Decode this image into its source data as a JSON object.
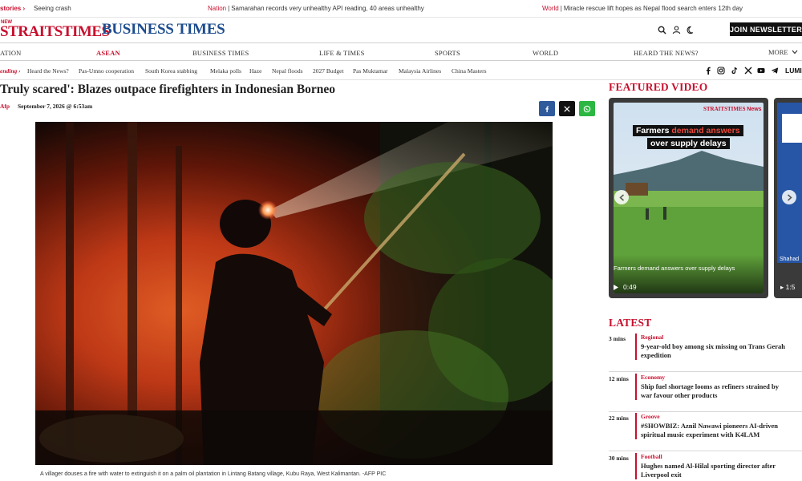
{
  "ticker": {
    "label": "stories ›",
    "items": [
      {
        "category": "",
        "text": "Seeing crash"
      },
      {
        "category": "Nation",
        "text": "Samarahan records very unhealthy API reading, 40 areas unhealthy"
      },
      {
        "category": "World",
        "text": "Miracle rescue lift hopes as Nepal flood search enters 12th day"
      }
    ]
  },
  "masthead": {
    "nst_small": "NEW",
    "nst_logo": "STRAITSTIMES",
    "bt_logo": "BUSINESS TIMES",
    "join_label": "JOIN NEWSLETTER"
  },
  "nav": {
    "items": [
      "ATION",
      "ASEAN",
      "BUSINESS TIMES",
      "LIFE & TIMES",
      "SPORTS",
      "WORLD",
      "HEARD THE NEWS?"
    ],
    "active": "ASEAN",
    "more": "MORE"
  },
  "trending": {
    "label": "ending ›",
    "items": [
      "Heard the News?",
      "Pas-Umno cooperation",
      "South Korea stabbing",
      "Melaka polls",
      "Haze",
      "Nepal floods",
      "2027 Budget",
      "Pas Muktamar",
      "Malaysia Airlines",
      "China Masters"
    ],
    "social_trailing": "LUMI"
  },
  "article": {
    "headline": "Truly scared': Blazes outpace firefighters in Indonesian Borneo",
    "author": "Afp",
    "date": "September 7, 2026 @ 6:53am",
    "caption": "A villager douses a fire with water to extinguish it on a palm oil plantation in Lintang Batang village, Kubu Raya, West Kalimantan. -AFP PIC"
  },
  "featured": {
    "title": "FEATURED VIDEO",
    "video": {
      "logo": "STRAITSTIMES",
      "logo_suffix": "News",
      "headline_white_1": "Farmers ",
      "headline_red": "demand answers",
      "headline_white_2": "over supply delays",
      "caption": "Farmers demand answers over supply delays",
      "duration": "0:49"
    },
    "video2": {
      "duration": "1:5",
      "caption": "Shahad"
    }
  },
  "latest": {
    "title": "LATEST",
    "items": [
      {
        "time": "3 mins",
        "category": "Regional",
        "title_1": "9-year-old boy among six missing on Trans Gerah",
        "title_2": "expedition"
      },
      {
        "time": "12 mins",
        "category": "Economy",
        "title_1": "Ship fuel shortage looms as refiners strained by",
        "title_2": "war favour other products"
      },
      {
        "time": "22 mins",
        "category": "Groove",
        "title_1": "#SHOWBIZ: Aznil Nawawi pioneers AI-driven",
        "title_2": "spiritual music experiment with K4LAM"
      },
      {
        "time": "30 mins",
        "category": "Football",
        "title_1": "Hughes named Al-Hilal sporting director after",
        "title_2": "Liverpool exit"
      }
    ]
  }
}
